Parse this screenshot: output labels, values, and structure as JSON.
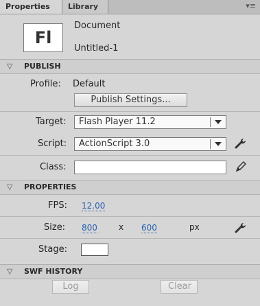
{
  "tabs": [
    {
      "label": "Properties"
    },
    {
      "label": "Library"
    }
  ],
  "panel_menu_icon": "panel-menu-icon",
  "document": {
    "icon_text": "Fl",
    "type_label": "Document",
    "name": "Untitled-1"
  },
  "sections": {
    "publish": {
      "title": "PUBLISH",
      "profile_label": "Profile:",
      "profile_value": "Default",
      "publish_settings_button": "Publish Settings...",
      "target_label": "Target:",
      "target_value": "Flash Player 11.2",
      "script_label": "Script:",
      "script_value": "ActionScript 3.0",
      "class_label": "Class:",
      "class_value": ""
    },
    "properties": {
      "title": "PROPERTIES",
      "fps_label": "FPS:",
      "fps_value": "12.00",
      "size_label": "Size:",
      "width_value": "800",
      "x_label": "x",
      "height_value": "600",
      "unit_label": "px",
      "stage_label": "Stage:"
    },
    "swf_history": {
      "title": "SWF HISTORY",
      "log_button": "Log",
      "clear_button": "Clear"
    }
  },
  "colors": {
    "panel_bg": "#d6d6d6",
    "link_blue": "#2a60b0",
    "stage_color": "#ffffff"
  },
  "icons": {
    "wrench": "wrench-icon",
    "pencil": "pencil-icon",
    "chevron": "chevron-down-icon"
  }
}
